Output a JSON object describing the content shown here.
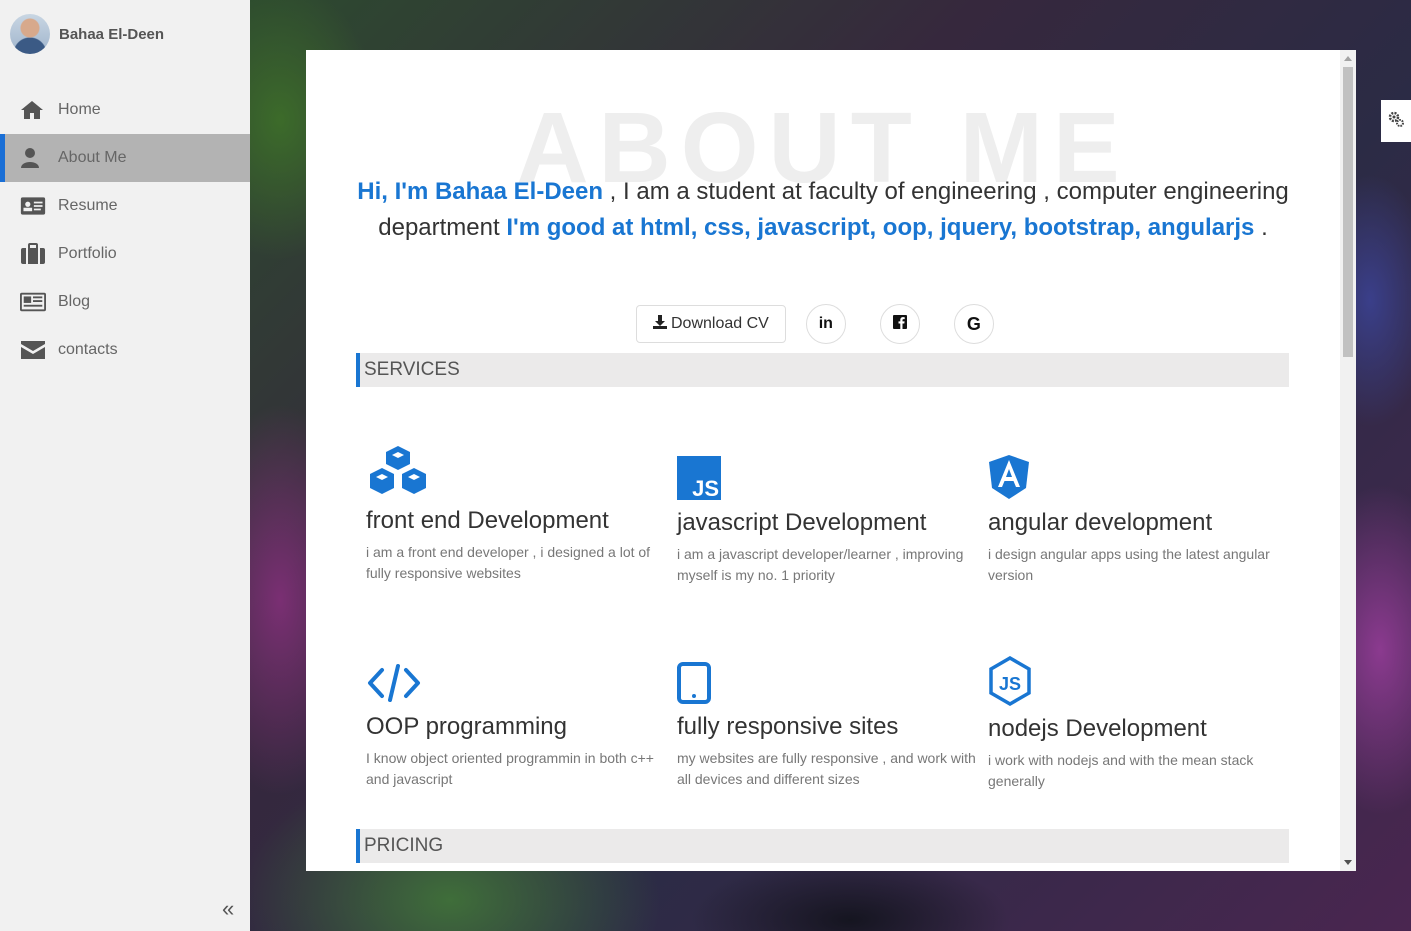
{
  "sidebar": {
    "profile_name": "Bahaa El-Deen",
    "items": [
      {
        "label": "Home",
        "icon": "home-icon"
      },
      {
        "label": "About Me",
        "icon": "user-icon",
        "active": true
      },
      {
        "label": "Resume",
        "icon": "id-card-icon"
      },
      {
        "label": "Portfolio",
        "icon": "briefcase-icon"
      },
      {
        "label": "Blog",
        "icon": "newspaper-icon"
      },
      {
        "label": "contacts",
        "icon": "envelope-icon"
      }
    ],
    "collapse_glyph": "«"
  },
  "about": {
    "watermark": "ABOUT ME",
    "intro_hi": "Hi, I'm Bahaa El-Deen",
    "intro_mid": " , I am a student at faculty of engineering , computer engineering department ",
    "intro_skills": "I'm good at html, css, javascript, oop, jquery, bootstrap, angularjs",
    "intro_end": " .",
    "download_cv": "Download CV",
    "social": {
      "linkedin": "in",
      "facebook": "f",
      "google": "G"
    }
  },
  "services": {
    "heading": "SERVICES",
    "items": [
      {
        "title": "front end Development",
        "desc": "i am a front end developer , i designed a lot of fully responsive websites",
        "icon": "cubes-icon"
      },
      {
        "title": "javascript Development",
        "desc": "i am a javascript developer/learner , improving myself is my no. 1 priority",
        "icon": "js-icon"
      },
      {
        "title": "angular development",
        "desc": "i design angular apps using the latest angular version",
        "icon": "angular-icon"
      },
      {
        "title": "OOP programming",
        "desc": "I know object oriented programmin in both c++ and javascript",
        "icon": "code-icon"
      },
      {
        "title": "fully responsive sites",
        "desc": "my websites are fully responsive , and work with all devices and different sizes",
        "icon": "tablet-icon"
      },
      {
        "title": "nodejs Development",
        "desc": "i work with nodejs and with the mean stack generally",
        "icon": "nodejs-icon"
      }
    ]
  },
  "pricing": {
    "heading": "PRICING"
  },
  "colors": {
    "accent": "#1976d2",
    "sidebar_bg": "#f1f1f1",
    "active_bg": "#b3b3b3"
  }
}
